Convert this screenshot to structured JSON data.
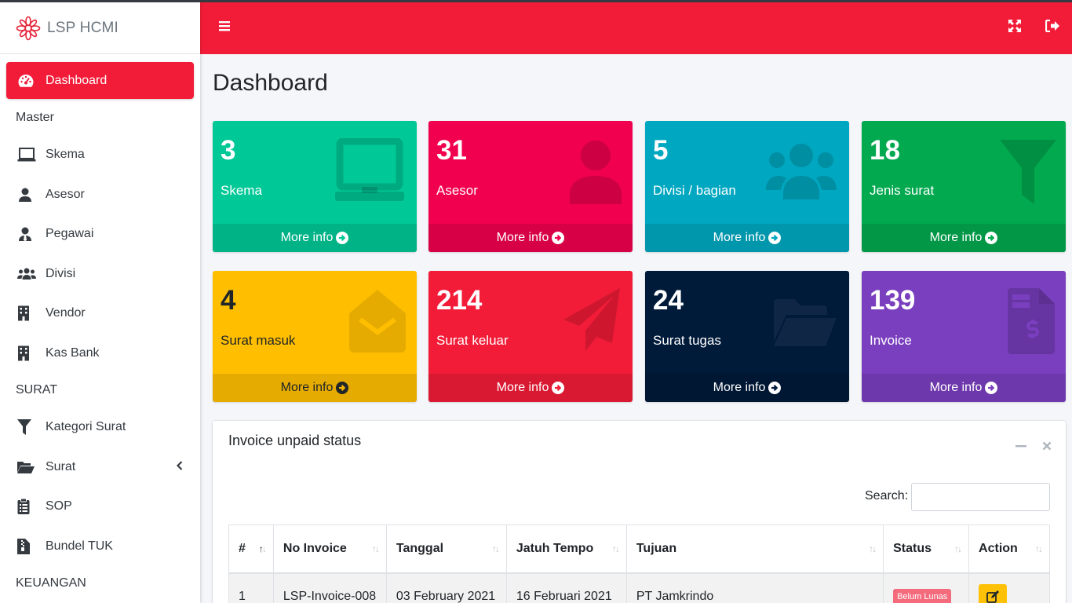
{
  "brand": {
    "name": "LSP HCMI",
    "logo_icon": "flower-logo-icon",
    "accent": "#f21c38"
  },
  "sidebar": {
    "items": [
      {
        "label": "Dashboard",
        "icon": "tachometer-icon",
        "active": true
      },
      {
        "header": "Master"
      },
      {
        "label": "Skema",
        "icon": "laptop-icon"
      },
      {
        "label": "Asesor",
        "icon": "user-icon"
      },
      {
        "label": "Pegawai",
        "icon": "user-tie-icon"
      },
      {
        "label": "Divisi",
        "icon": "users-icon"
      },
      {
        "label": "Vendor",
        "icon": "building-icon"
      },
      {
        "label": "Kas Bank",
        "icon": "building-icon"
      },
      {
        "header": "SURAT"
      },
      {
        "label": "Kategori Surat",
        "icon": "filter-icon"
      },
      {
        "label": "Surat",
        "icon": "folder-open-icon",
        "has_children": true
      },
      {
        "label": "SOP",
        "icon": "clipboard-list-icon"
      },
      {
        "label": "Bundel TUK",
        "icon": "file-archive-icon"
      },
      {
        "header": "KEUANGAN"
      }
    ]
  },
  "topbar": {
    "menu_icon": "bars-icon",
    "fullscreen_icon": "expand-arrows-icon",
    "logout_icon": "sign-out-icon"
  },
  "page": {
    "title": "Dashboard"
  },
  "boxes": [
    {
      "value": "3",
      "label": "Skema",
      "more": "More info",
      "color": "#00c897",
      "icon": "laptop-icon"
    },
    {
      "value": "31",
      "label": "Asesor",
      "more": "More info",
      "color": "#f0004f",
      "icon": "user-icon"
    },
    {
      "value": "5",
      "label": "Divisi / bagian",
      "more": "More info",
      "color": "#00a7c0",
      "icon": "users-icon"
    },
    {
      "value": "18",
      "label": "Jenis surat",
      "more": "More info",
      "color": "#02a94f",
      "icon": "filter-icon"
    },
    {
      "value": "4",
      "label": "Surat masuk",
      "more": "More info",
      "color": "#ffbf00",
      "icon": "envelope-open-icon"
    },
    {
      "value": "214",
      "label": "Surat keluar",
      "more": "More info",
      "color": "#f21c38",
      "icon": "paper-plane-icon"
    },
    {
      "value": "24",
      "label": "Surat tugas",
      "more": "More info",
      "color": "#001a3a",
      "icon": "folder-open-icon"
    },
    {
      "value": "139",
      "label": "Invoice",
      "more": "More info",
      "color": "#7a3fbf",
      "icon": "file-invoice-dollar-icon"
    }
  ],
  "invoice_card": {
    "title": "Invoice unpaid status",
    "search_label": "Search:",
    "search_value": "",
    "columns": [
      "#",
      "No Invoice",
      "Tanggal",
      "Jatuh Tempo",
      "Tujuan",
      "Status",
      "Action"
    ],
    "rows": [
      {
        "no": "1",
        "invoice": "LSP-Invoice-008",
        "tanggal": "03 February 2021",
        "jatuh_tempo": "16 Februari 2021",
        "tujuan": "PT Jamkrindo",
        "status": "Belum Lunas",
        "action_icon": "edit-icon"
      }
    ]
  }
}
